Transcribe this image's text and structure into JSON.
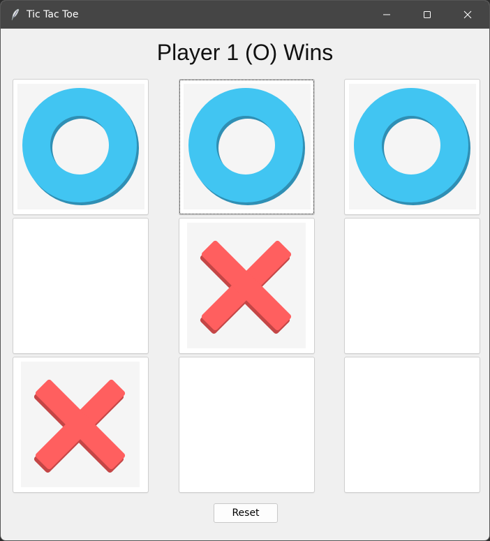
{
  "window": {
    "title": "Tic Tac Toe",
    "controls": [
      "minimize-icon",
      "maximize-icon",
      "close-icon"
    ]
  },
  "status": {
    "text": "Player 1 (O) Wins"
  },
  "board": {
    "cells": [
      "O",
      "O",
      "O",
      "",
      "X",
      "",
      "X",
      "",
      ""
    ],
    "winner": "O",
    "focused_cell": 1
  },
  "reset": {
    "label": "Reset"
  },
  "colors": {
    "titlebar": "#454545",
    "o_mark": "#41c5f2",
    "o_shadow": "#2f8fb4",
    "x_mark": "#ff5f5f",
    "x_shadow": "#c44646",
    "tile": "#f5f5f5"
  }
}
